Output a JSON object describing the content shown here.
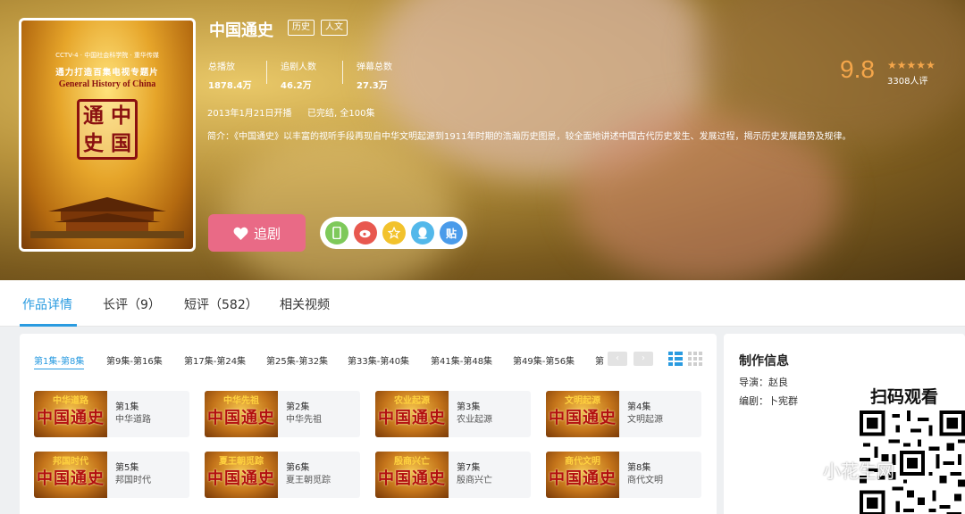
{
  "show": {
    "title": "中国通史",
    "tags": [
      "历史",
      "人文"
    ],
    "poster_text": {
      "line1": "CCTV-4 · 中国社会科学院 · 重华传媒",
      "line2": "通力打造百集电视专题片",
      "english_title": "General History of China",
      "seal_chars": [
        "通",
        "中",
        "史",
        "国"
      ]
    },
    "stats": [
      {
        "label": "总播放",
        "value": "1878.4万"
      },
      {
        "label": "追剧人数",
        "value": "46.2万"
      },
      {
        "label": "弹幕总数",
        "value": "27.3万"
      }
    ],
    "air_date": "2013年1月21日开播",
    "status": "已完结, 全100集",
    "synopsis": "简介：《中国通史》以丰富的视听手段再现自中华文明起源到1911年时期的浩瀚历史图景，较全面地讲述中国古代历史发生、发展过程，揭示历史发展趋势及规律。",
    "rating": {
      "score": "9.8",
      "stars": 5,
      "raters": "3308人评"
    },
    "follow_label": "追剧"
  },
  "share_icons": [
    {
      "name": "phone-icon",
      "glyph": "▯",
      "color": "#7ec95a"
    },
    {
      "name": "weibo-icon",
      "glyph": "◎",
      "color": "#e8584f"
    },
    {
      "name": "star-icon",
      "glyph": "☆",
      "color": "#f2c22c"
    },
    {
      "name": "qq-icon",
      "glyph": "●",
      "color": "#53b8ea"
    },
    {
      "name": "tieba-icon",
      "glyph": "贴",
      "color": "#4a9bea"
    }
  ],
  "tabs": [
    {
      "label": "作品详情",
      "active": true
    },
    {
      "label": "长评（9）",
      "active": false
    },
    {
      "label": "短评（582）",
      "active": false
    },
    {
      "label": "相关视频",
      "active": false
    }
  ],
  "episode_ranges": [
    "第1集-第8集",
    "第9集-第16集",
    "第17集-第24集",
    "第25集-第32集",
    "第33集-第40集",
    "第41集-第48集",
    "第49集-第56集",
    "第"
  ],
  "episodes": [
    {
      "num": "第1集",
      "name": "中华道路",
      "thumb_top": "中华道路"
    },
    {
      "num": "第2集",
      "name": "中华先祖",
      "thumb_top": "中华先祖"
    },
    {
      "num": "第3集",
      "name": "农业起源",
      "thumb_top": "农业起源"
    },
    {
      "num": "第4集",
      "name": "文明起源",
      "thumb_top": "文明起源"
    },
    {
      "num": "第5集",
      "name": "邦国时代",
      "thumb_top": "邦国时代"
    },
    {
      "num": "第6集",
      "name": "夏王朝觅踪",
      "thumb_top": "夏王朝觅踪"
    },
    {
      "num": "第7集",
      "name": "殷商兴亡",
      "thumb_top": "殷商兴亡"
    },
    {
      "num": "第8集",
      "name": "商代文明",
      "thumb_top": "商代文明"
    }
  ],
  "thumb_main": "中国通史",
  "production": {
    "title": "制作信息",
    "director": "导演：赵良",
    "writer": "编剧：卜宪群",
    "scan_text": "扫码观看"
  },
  "watermark": "小花生网",
  "colors": {
    "accent": "#2a9be0",
    "follow": "#e96a86",
    "rating": "#f5a64a"
  }
}
